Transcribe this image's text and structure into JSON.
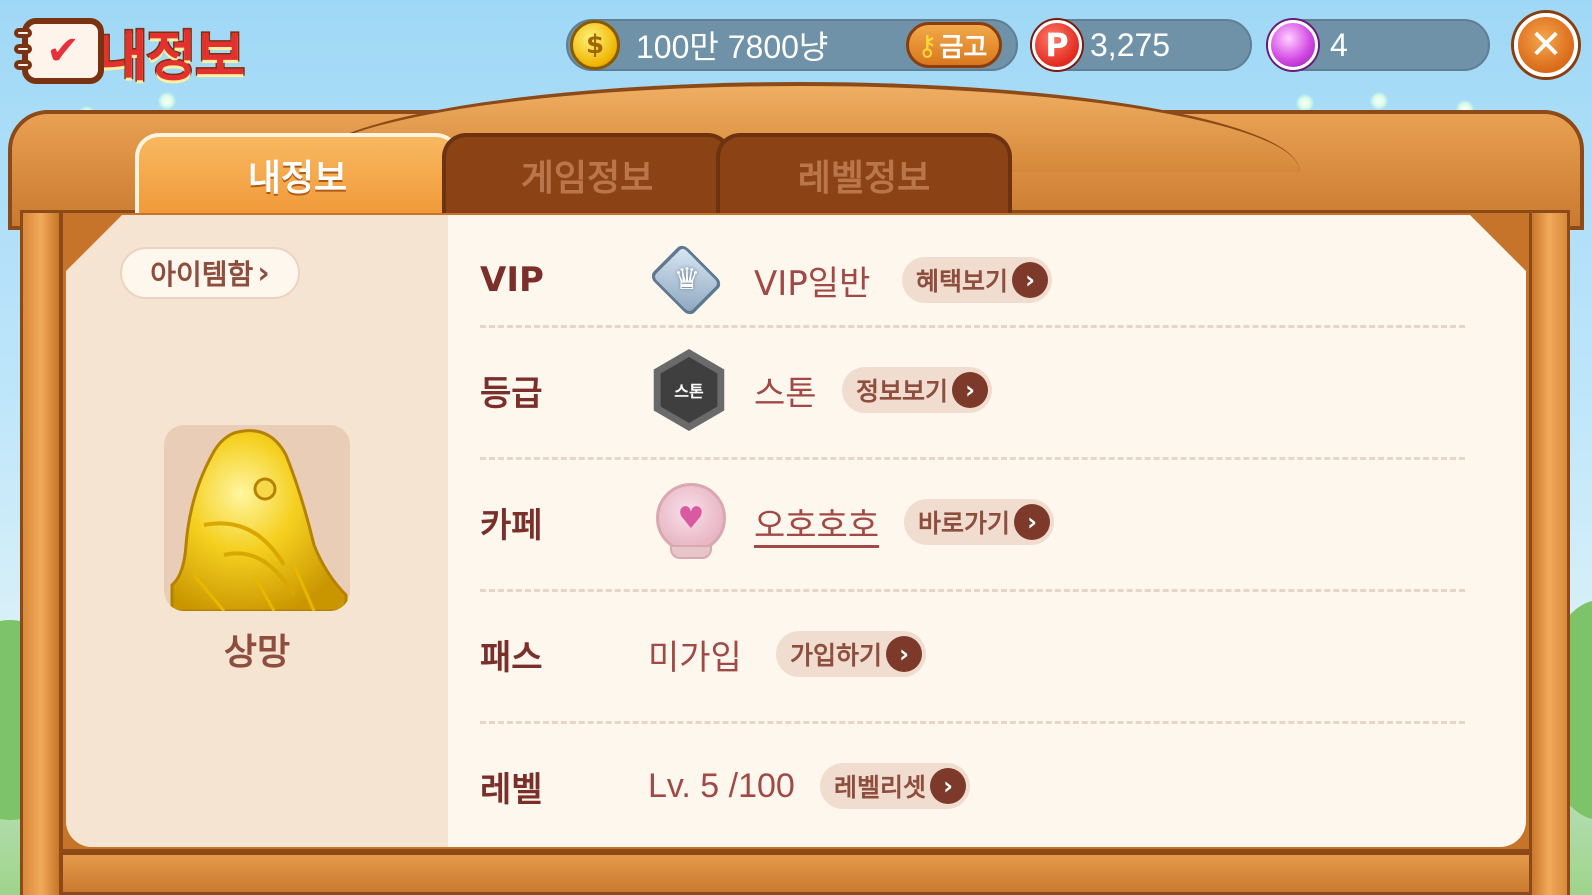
{
  "title": "내정보",
  "currency": {
    "gold": "100만 7800냥",
    "vault_label": "금고",
    "points_icon": "P",
    "points": "3,275",
    "gems": "4"
  },
  "tabs": [
    {
      "label": "내정보",
      "active": true
    },
    {
      "label": "게임정보",
      "active": false
    },
    {
      "label": "레벨정보",
      "active": false
    }
  ],
  "left": {
    "items_button": "아이템함",
    "nickname": "상망"
  },
  "rows": {
    "vip": {
      "label": "VIP",
      "value": "VIP일반",
      "button": "혜택보기"
    },
    "grade": {
      "label": "등급",
      "value": "스톤",
      "badge": "스톤",
      "button": "정보보기"
    },
    "cafe": {
      "label": "카페",
      "value": "오호호호",
      "button": "바로가기"
    },
    "pass": {
      "label": "패스",
      "value": "미가입",
      "button": "가입하기"
    },
    "level": {
      "label": "레벨",
      "value": "Lv. 5 /100",
      "button": "레벨리셋"
    }
  },
  "colors": {
    "wood": "#c5742a",
    "panel": "#fdf7ee",
    "label_text": "#7a2f2a",
    "value_text": "#a14a45",
    "active_tab": "#f09a3a"
  },
  "icons": {
    "gold": "coin-icon",
    "vault": "key-icon",
    "points": "p-point-icon",
    "gems": "gem-icon",
    "close": "close-icon",
    "vip": "vip-crown-diamond-icon",
    "grade": "stone-grade-icon",
    "cafe": "bird-cafe-icon",
    "avatar": "golden-fish-icon"
  }
}
